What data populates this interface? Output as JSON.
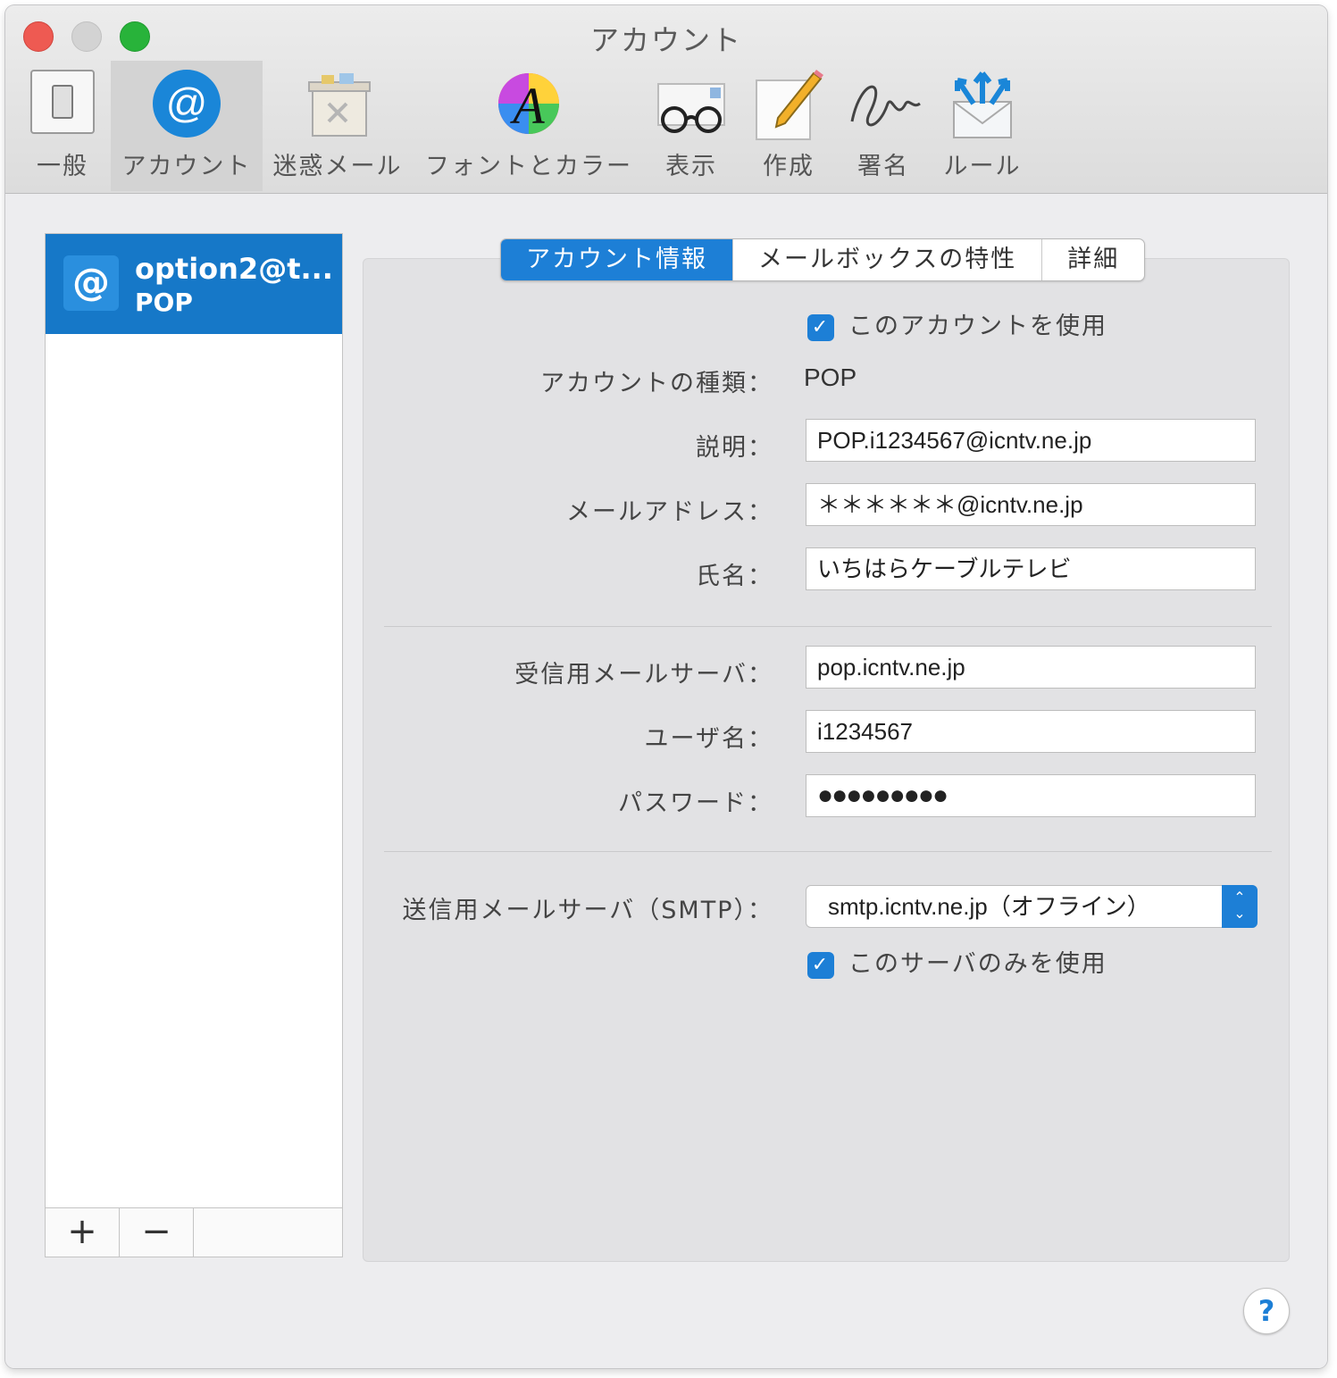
{
  "window": {
    "title": "アカウント"
  },
  "toolbar": {
    "items": [
      {
        "label": "一般",
        "icon": "general-switch-icon"
      },
      {
        "label": "アカウント",
        "icon": "at-sign-icon"
      },
      {
        "label": "迷惑メール",
        "icon": "junk-bin-icon"
      },
      {
        "label": "フォントとカラー",
        "icon": "font-color-icon"
      },
      {
        "label": "表示",
        "icon": "glasses-icon"
      },
      {
        "label": "作成",
        "icon": "pencil-note-icon"
      },
      {
        "label": "署名",
        "icon": "signature-icon"
      },
      {
        "label": "ルール",
        "icon": "rules-envelope-icon"
      }
    ],
    "active": "アカウント"
  },
  "accounts": {
    "items": [
      {
        "name": "option2@t...",
        "type": "POP",
        "icon_symbol": "@"
      }
    ],
    "add_label": "+",
    "remove_label": "−"
  },
  "tabs": [
    "アカウント情報",
    "メールボックスの特性",
    "詳細"
  ],
  "form": {
    "use_account": {
      "label": "このアカウントを使用",
      "checked": true
    },
    "account_type": {
      "label": "アカウントの種類：",
      "value": "POP"
    },
    "description": {
      "label": "説明：",
      "value": "POP.i1234567@icntv.ne.jp"
    },
    "email": {
      "label": "メールアドレス：",
      "value": "＊＊＊＊＊＊@icntv.ne.jp"
    },
    "full_name": {
      "label": "氏名：",
      "value": "いちはらケーブルテレビ"
    },
    "incoming_server": {
      "label": "受信用メールサーバ：",
      "value": "pop.icntv.ne.jp"
    },
    "username": {
      "label": "ユーザ名：",
      "value": "i1234567"
    },
    "password": {
      "label": "パスワード：",
      "value": "●●●●●●●●●"
    },
    "smtp": {
      "label": "送信用メールサーバ（SMTP）：",
      "value": "smtp.icntv.ne.jp（オフライン）"
    },
    "only_this_server": {
      "label": "このサーバのみを使用",
      "checked": true
    }
  },
  "help": {
    "label": "?"
  },
  "colors": {
    "accent": "#1d7fd6",
    "close": "#ee5a52",
    "minimize": "#d3d3d3",
    "zoom": "#28b33a"
  }
}
